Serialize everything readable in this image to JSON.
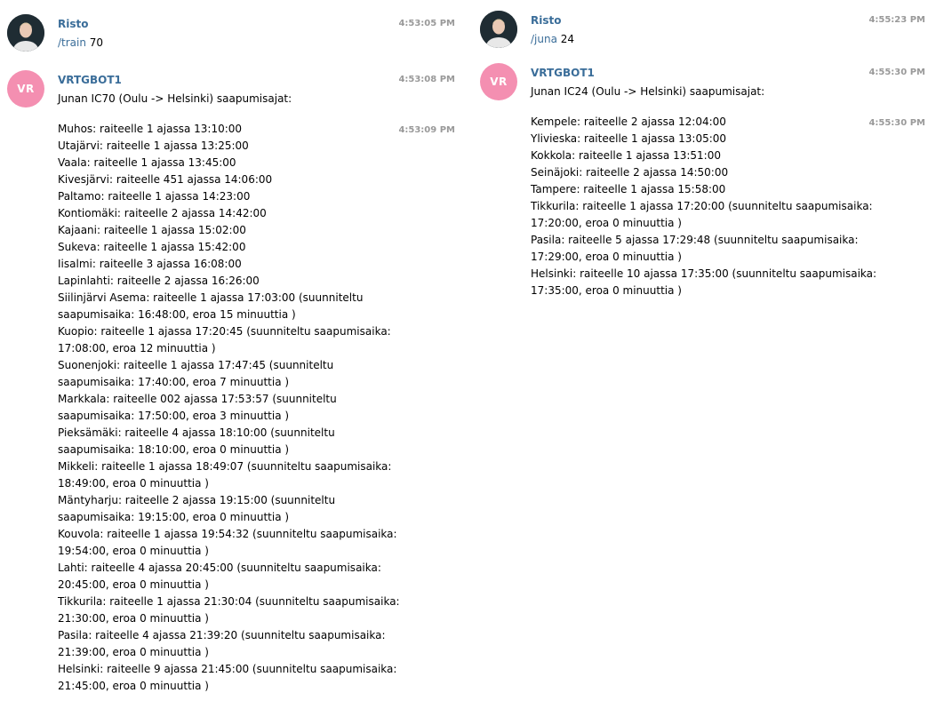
{
  "left": {
    "user_message": {
      "sender": "Risto",
      "time": "4:53:05 PM",
      "command": "/train",
      "argument": " 70"
    },
    "bot_message": {
      "avatar_initials": "VR",
      "sender": "VRTGBOT1",
      "time_header": "4:53:08 PM",
      "header": "Junan IC70 (Oulu -> Helsinki) saapumisajat:",
      "time_list": "4:53:09 PM",
      "lines": [
        "Muhos: raiteelle 1 ajassa 13:10:00",
        "Utajärvi: raiteelle 1 ajassa 13:25:00",
        "Vaala: raiteelle 1 ajassa 13:45:00",
        "Kivesjärvi: raiteelle 451 ajassa 14:06:00",
        "Paltamo: raiteelle 1 ajassa 14:23:00",
        "Kontiomäki: raiteelle 2 ajassa 14:42:00",
        "Kajaani: raiteelle 1 ajassa 15:02:00",
        "Sukeva: raiteelle 1 ajassa 15:42:00",
        "Iisalmi: raiteelle 3 ajassa 16:08:00",
        "Lapinlahti: raiteelle 2 ajassa 16:26:00",
        "Siilinjärvi Asema: raiteelle 1 ajassa 17:03:00 (suunniteltu",
        "saapumisaika: 16:48:00, eroa 15 minuuttia )",
        "Kuopio: raiteelle 1 ajassa 17:20:45 (suunniteltu saapumisaika:",
        "17:08:00, eroa 12 minuuttia )",
        "Suonenjoki: raiteelle 1 ajassa 17:47:45 (suunniteltu",
        "saapumisaika: 17:40:00, eroa 7 minuuttia )",
        "Markkala: raiteelle 002 ajassa 17:53:57 (suunniteltu",
        "saapumisaika: 17:50:00, eroa 3 minuuttia )",
        "Pieksämäki: raiteelle 4 ajassa 18:10:00 (suunniteltu",
        "saapumisaika: 18:10:00, eroa 0 minuuttia )",
        "Mikkeli: raiteelle 1 ajassa 18:49:07 (suunniteltu saapumisaika:",
        "18:49:00, eroa 0 minuuttia )",
        "Mäntyharju: raiteelle 2 ajassa 19:15:00 (suunniteltu",
        "saapumisaika: 19:15:00, eroa 0 minuuttia )",
        "Kouvola: raiteelle 1 ajassa 19:54:32 (suunniteltu saapumisaika:",
        "19:54:00, eroa 0 minuuttia )",
        "Lahti: raiteelle 4 ajassa 20:45:00 (suunniteltu saapumisaika:",
        "20:45:00, eroa 0 minuuttia )",
        "Tikkurila: raiteelle 1 ajassa 21:30:04 (suunniteltu saapumisaika:",
        "21:30:00, eroa 0 minuuttia )",
        "Pasila: raiteelle 4 ajassa 21:39:20 (suunniteltu saapumisaika:",
        "21:39:00, eroa 0 minuuttia )",
        "Helsinki: raiteelle 9 ajassa 21:45:00 (suunniteltu saapumisaika:",
        "21:45:00, eroa 0 minuuttia )"
      ]
    }
  },
  "right": {
    "user_message": {
      "sender": "Risto",
      "time": "4:55:23 PM",
      "command": "/juna",
      "argument": " 24"
    },
    "bot_message": {
      "avatar_initials": "VR",
      "sender": "VRTGBOT1",
      "time_header": "4:55:30 PM",
      "header": "Junan IC24 (Oulu -> Helsinki) saapumisajat:",
      "time_list": "4:55:30 PM",
      "lines": [
        "Kempele: raiteelle 2 ajassa 12:04:00",
        "Ylivieska: raiteelle 1 ajassa 13:05:00",
        "Kokkola: raiteelle 1 ajassa 13:51:00",
        "Seinäjoki: raiteelle 2 ajassa 14:50:00",
        "Tampere: raiteelle 1 ajassa 15:58:00",
        "Tikkurila: raiteelle 1 ajassa 17:20:00 (suunniteltu saapumisaika:",
        "17:20:00, eroa 0 minuuttia )",
        "Pasila: raiteelle 5 ajassa 17:29:48 (suunniteltu saapumisaika:",
        "17:29:00, eroa 0 minuuttia )",
        "Helsinki: raiteelle 10 ajassa 17:35:00 (suunniteltu saapumisaika:",
        "17:35:00, eroa 0 minuuttia )"
      ]
    }
  }
}
